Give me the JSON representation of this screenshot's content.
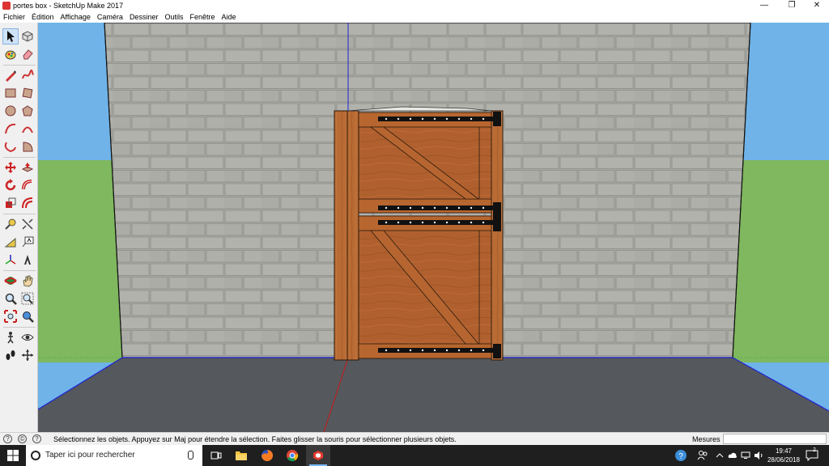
{
  "window": {
    "title": "portes box - SketchUp Make 2017",
    "minimize": "—",
    "maximize": "❐",
    "close": "✕"
  },
  "menu": {
    "items": [
      "Fichier",
      "Édition",
      "Affichage",
      "Caméra",
      "Dessiner",
      "Outils",
      "Fenêtre",
      "Aide"
    ]
  },
  "toolbar": {
    "active_tool": "select-tool"
  },
  "status": {
    "hint": "Sélectionnez les objets. Appuyez sur Maj pour étendre la sélection. Faites glisser la souris pour sélectionner plusieurs objets.",
    "measures_label": "Mesures",
    "measures_value": ""
  },
  "taskbar": {
    "search_placeholder": "Taper ici pour rechercher",
    "clock_time": "19:47",
    "clock_date": "28/06/2018",
    "notification_count": "2"
  },
  "colors": {
    "sky": "#6fb3e8",
    "grass": "#7fb85e",
    "ground": "#55585c",
    "wall": "#a9a9a4",
    "door_wood": "#b0602e",
    "frame_wood": "#b96b34",
    "hinge": "#111111",
    "axis_blue": "#1f22d6",
    "axis_red": "#c81818",
    "axis_green": "#39a639"
  }
}
